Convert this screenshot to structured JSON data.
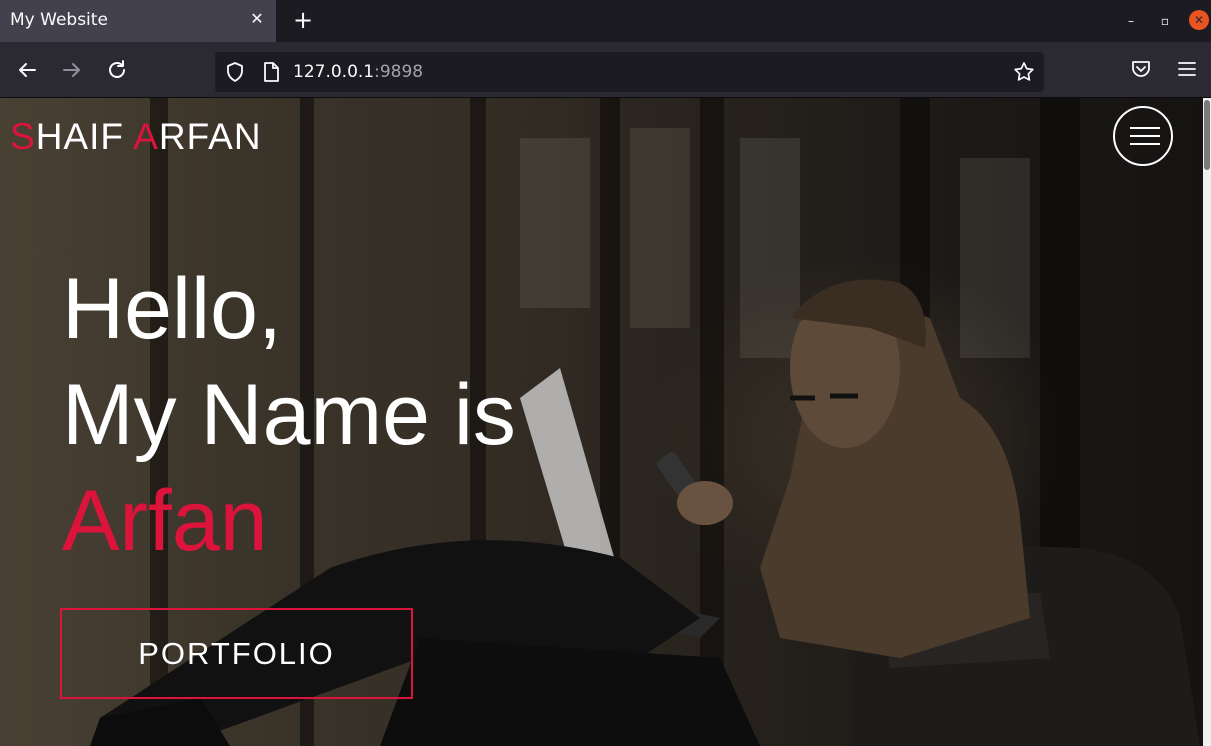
{
  "browser": {
    "tab_title": "My Website",
    "tab_close_icon": "close-icon",
    "new_tab_icon": "plus-icon",
    "url_host": "127.0.0.1",
    "url_port": ":9898",
    "window_controls": [
      "minimize-icon",
      "maximize-icon",
      "close-icon"
    ]
  },
  "site": {
    "logo_first_initial": "S",
    "logo_first_rest": "HAIF ",
    "logo_last_initial": "A",
    "logo_last_rest": "RFAN",
    "hero_line1": "Hello,",
    "hero_line2": "My Name is",
    "hero_name": "Arfan",
    "cta_label": "PORTFOLIO"
  },
  "colors": {
    "accent": "#dc143c",
    "browser_close": "#e95420"
  }
}
